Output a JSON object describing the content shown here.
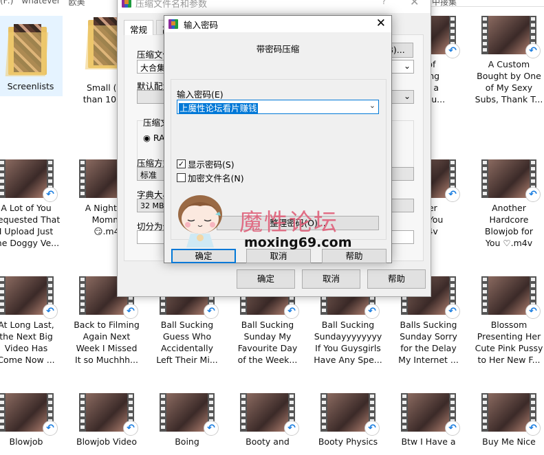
{
  "explorer": {
    "breadcrumb": [
      "(F:)",
      "whatever",
      "欧美"
    ],
    "breadcrumb_right": "中接集",
    "items": [
      {
        "label": "Screenlists",
        "type": "folder",
        "selected": true
      },
      {
        "label": "Small (Le\nthan 100m",
        "type": "folder"
      },
      {
        "label": "",
        "type": "hidden"
      },
      {
        "label": "",
        "type": "hidden"
      },
      {
        "label": "",
        "type": "hidden"
      },
      {
        "label": "t of\nthing\nIt's a\nhe Cu...",
        "type": "video"
      },
      {
        "label": "A Custom\nBought by One\nof My Sexy\nSubs, Thank T...",
        "type": "video"
      },
      {
        "label": "A Lot of You\nRequested That\nI Upload Just\nthe Doggy Ve...",
        "type": "video"
      },
      {
        "label": "A Night W\nMomm\n😏.m4",
        "type": "video"
      },
      {
        "label": "",
        "type": "hidden"
      },
      {
        "label": "",
        "type": "hidden"
      },
      {
        "label": "",
        "type": "hidden"
      },
      {
        "label": "ther\nfor You\nm4v",
        "type": "video"
      },
      {
        "label": "Another\nHardcore\nBlowjob for\nYou ♡.m4v",
        "type": "video"
      },
      {
        "label": "At Long Last,\nthe Next Big\nVideo Has\nCome Now ...",
        "type": "video"
      },
      {
        "label": "Back to Filming\nAgain Next\nWeek I Missed\nIt so Muchhh...",
        "type": "video"
      },
      {
        "label": "Ball Sucking\nGuess Who\nAccidentally\nLeft Their Mi...",
        "type": "video"
      },
      {
        "label": "Ball Sucking\nSunday My\nFavourite Day\nof the Week...",
        "type": "video"
      },
      {
        "label": "Ball Sucking\nSundayyyyyyyy\nIf You Guysgirls\nHave Any Spe...",
        "type": "video"
      },
      {
        "label": "Balls Sucking\nSunday Sorry\nfor the Delay\nMy Internet ...",
        "type": "video"
      },
      {
        "label": "Blossom\nPresenting Her\nCute Pink Pussy\nto Her New F...",
        "type": "video"
      },
      {
        "label": "Blowjob",
        "type": "video"
      },
      {
        "label": "Blowjob Video",
        "type": "video"
      },
      {
        "label": "Boing",
        "type": "video"
      },
      {
        "label": "Booty and",
        "type": "video"
      },
      {
        "label": "Booty Physics",
        "type": "video"
      },
      {
        "label": "Btw I Have a",
        "type": "video"
      },
      {
        "label": "Buy Me Nice",
        "type": "video"
      }
    ]
  },
  "archive_dialog": {
    "title": "压缩文件名和参数",
    "help_glyph": "?",
    "tabs": [
      "常规",
      "高"
    ],
    "archive_name_label": "压缩文件",
    "archive_name_value": "大合集",
    "browse_label": "B)...",
    "profile_label": "默认配置",
    "format_label": "压缩文",
    "format_option": "RAR",
    "method_label": "压缩方式",
    "method_value": "标准",
    "dict_label": "字典大小",
    "dict_value": "32 MB",
    "split_label": "切分为分",
    "ok": "确定",
    "cancel": "取消",
    "help": "帮助"
  },
  "password_dialog": {
    "title": "输入密码",
    "subtitle": "带密码压缩",
    "password_label": "输入密码(E)",
    "password_value": "上魔性论坛看片赚钱",
    "show_password": {
      "label": "显示密码(S)",
      "checked": true
    },
    "encrypt_names": {
      "label": "加密文件名(N)",
      "checked": false
    },
    "organize_button": "整理密码(O)...",
    "ok": "确定",
    "cancel": "取消",
    "help": "帮助"
  },
  "watermark": {
    "text": "魔性论坛",
    "url": "moxing69.com"
  },
  "colors": {
    "accent": "#0078d7",
    "selection": "#e5f3ff",
    "watermark": "#e0607a"
  }
}
